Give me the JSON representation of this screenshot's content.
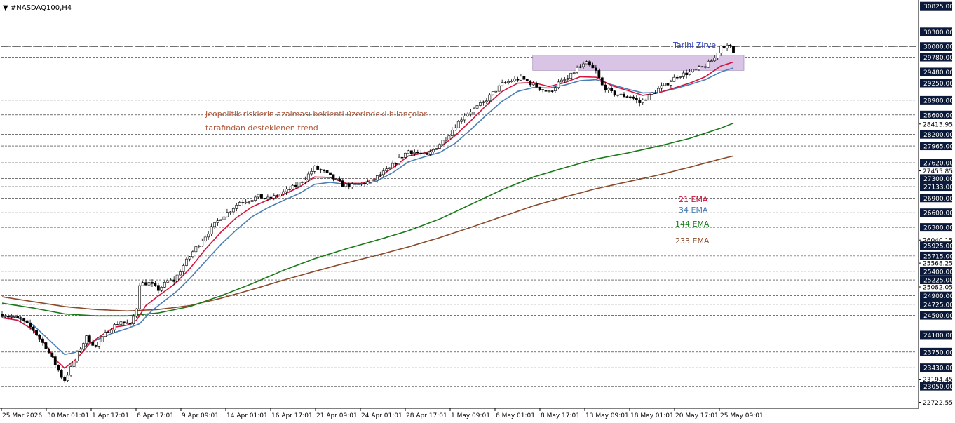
{
  "chart_data": {
    "type": "candlestick",
    "title": "#NASDAQ100,H4",
    "title_marker": "▼",
    "ylim": [
      22600,
      30950
    ],
    "grid": true,
    "background": "#ffffff",
    "colors": {
      "ema21": "#d4143c",
      "ema34": "#4a7fb5",
      "ema144": "#1a7a1a",
      "ema233": "#8b4a2b",
      "zone": "#d9c4e6",
      "ath_line": "#1a1a1a",
      "label_box": "#0b1a3a",
      "annotation_trend": "#b0583a",
      "annotation_ath": "#2b40c0"
    },
    "y_ticks_boxed": [
      "30825.00",
      "30300.00",
      "30000.00",
      "29780.00",
      "29480.00",
      "29250.00",
      "28900.00",
      "28600.00",
      "28200.00",
      "27965.00",
      "27620.00",
      "27300.00",
      "27133.00",
      "26900.00",
      "26600.00",
      "26300.00",
      "25925.00",
      "25715.00",
      "25400.00",
      "25225.00",
      "24900.00",
      "24725.00",
      "24500.00",
      "24100.00",
      "23750.00",
      "23430.00",
      "23050.00"
    ],
    "y_ticks_plain": [
      "28413.95",
      "27455.85",
      "26040.15",
      "25568.25",
      "25082.05",
      "23194.45",
      "22722.55"
    ],
    "x_ticks": [
      "25 Mar 2026",
      "30 Mar 01:01",
      "1 Apr 17:01",
      "6 Apr 17:01",
      "9 Apr 09:01",
      "14 Apr 01:01",
      "16 Apr 17:01",
      "21 Apr 09:01",
      "24 Apr 01:01",
      "28 Apr 17:01",
      "1 May 09:01",
      "6 May 01:01",
      "8 May 17:01",
      "13 May 09:01",
      "18 May 01:01",
      "20 May 17:01",
      "25 May 09:01"
    ],
    "resistance_zone": [
      29510,
      29820
    ],
    "ath_level": 30000,
    "annotations": {
      "trend_line1": "Jeopolitik risklerin azalması beklenti üzerindeki bilançolar",
      "trend_line2": "tarafından desteklenen trend",
      "ath": "Tarihi Zirve"
    },
    "legend": [
      "21 EMA",
      "34 EMA",
      "144 EMA",
      "233 EMA"
    ],
    "price_path": [
      [
        0,
        24520
      ],
      [
        6,
        24420
      ],
      [
        10,
        24200
      ],
      [
        14,
        23850
      ],
      [
        17,
        23500
      ],
      [
        19,
        23250
      ],
      [
        20,
        23180
      ],
      [
        22,
        23420
      ],
      [
        24,
        23720
      ],
      [
        27,
        24050
      ],
      [
        30,
        23860
      ],
      [
        33,
        24120
      ],
      [
        35,
        24250
      ],
      [
        38,
        24380
      ],
      [
        41,
        24290
      ],
      [
        43,
        24660
      ],
      [
        44,
        25150
      ],
      [
        47,
        25160
      ],
      [
        50,
        25030
      ],
      [
        53,
        25200
      ],
      [
        55,
        25210
      ],
      [
        58,
        25520
      ],
      [
        61,
        25800
      ],
      [
        64,
        26050
      ],
      [
        67,
        26280
      ],
      [
        70,
        26500
      ],
      [
        73,
        26650
      ],
      [
        76,
        26820
      ],
      [
        79,
        26860
      ],
      [
        82,
        26930
      ],
      [
        85,
        26880
      ],
      [
        88,
        26950
      ],
      [
        91,
        27050
      ],
      [
        94,
        27150
      ],
      [
        97,
        27310
      ],
      [
        100,
        27520
      ],
      [
        103,
        27430
      ],
      [
        106,
        27300
      ],
      [
        109,
        27170
      ],
      [
        112,
        27150
      ],
      [
        115,
        27190
      ],
      [
        118,
        27230
      ],
      [
        121,
        27380
      ],
      [
        124,
        27500
      ],
      [
        127,
        27700
      ],
      [
        130,
        27870
      ],
      [
        133,
        27820
      ],
      [
        136,
        27760
      ],
      [
        139,
        27950
      ],
      [
        142,
        28130
      ],
      [
        145,
        28380
      ],
      [
        148,
        28600
      ],
      [
        151,
        28720
      ],
      [
        154,
        28850
      ],
      [
        157,
        29050
      ],
      [
        160,
        29230
      ],
      [
        163,
        29300
      ],
      [
        166,
        29350
      ],
      [
        169,
        29250
      ],
      [
        172,
        29150
      ],
      [
        175,
        29060
      ],
      [
        178,
        29250
      ],
      [
        181,
        29340
      ],
      [
        184,
        29550
      ],
      [
        187,
        29650
      ],
      [
        190,
        29490
      ],
      [
        192,
        29200
      ],
      [
        195,
        29050
      ],
      [
        198,
        29000
      ],
      [
        201,
        28980
      ],
      [
        204,
        28850
      ],
      [
        207,
        28990
      ],
      [
        210,
        29130
      ],
      [
        213,
        29250
      ],
      [
        216,
        29400
      ],
      [
        219,
        29450
      ],
      [
        222,
        29520
      ],
      [
        225,
        29600
      ],
      [
        228,
        29760
      ],
      [
        230,
        30020
      ],
      [
        233,
        29980
      ],
      [
        234,
        29880
      ]
    ],
    "ema21_path": [
      [
        0,
        24450
      ],
      [
        5,
        24400
      ],
      [
        10,
        24200
      ],
      [
        14,
        23900
      ],
      [
        17,
        23600
      ],
      [
        20,
        23420
      ],
      [
        24,
        23620
      ],
      [
        28,
        23920
      ],
      [
        32,
        24100
      ],
      [
        36,
        24260
      ],
      [
        40,
        24300
      ],
      [
        43,
        24400
      ],
      [
        46,
        24700
      ],
      [
        50,
        24900
      ],
      [
        55,
        25130
      ],
      [
        60,
        25450
      ],
      [
        65,
        25850
      ],
      [
        70,
        26200
      ],
      [
        75,
        26500
      ],
      [
        80,
        26720
      ],
      [
        85,
        26860
      ],
      [
        90,
        26970
      ],
      [
        95,
        27120
      ],
      [
        100,
        27330
      ],
      [
        105,
        27320
      ],
      [
        110,
        27200
      ],
      [
        115,
        27200
      ],
      [
        120,
        27300
      ],
      [
        125,
        27520
      ],
      [
        130,
        27760
      ],
      [
        135,
        27820
      ],
      [
        140,
        27930
      ],
      [
        145,
        28180
      ],
      [
        150,
        28480
      ],
      [
        155,
        28800
      ],
      [
        160,
        29080
      ],
      [
        165,
        29250
      ],
      [
        170,
        29260
      ],
      [
        175,
        29180
      ],
      [
        180,
        29260
      ],
      [
        185,
        29380
      ],
      [
        190,
        29370
      ],
      [
        195,
        29200
      ],
      [
        200,
        29100
      ],
      [
        205,
        29000
      ],
      [
        210,
        29050
      ],
      [
        215,
        29150
      ],
      [
        220,
        29250
      ],
      [
        225,
        29380
      ],
      [
        230,
        29600
      ],
      [
        234,
        29680
      ]
    ],
    "ema34_path": [
      [
        0,
        24500
      ],
      [
        5,
        24450
      ],
      [
        10,
        24300
      ],
      [
        15,
        24000
      ],
      [
        20,
        23700
      ],
      [
        24,
        23750
      ],
      [
        28,
        23930
      ],
      [
        32,
        24050
      ],
      [
        36,
        24150
      ],
      [
        40,
        24230
      ],
      [
        44,
        24330
      ],
      [
        48,
        24600
      ],
      [
        52,
        24800
      ],
      [
        56,
        25000
      ],
      [
        60,
        25250
      ],
      [
        65,
        25600
      ],
      [
        70,
        25950
      ],
      [
        75,
        26250
      ],
      [
        80,
        26520
      ],
      [
        85,
        26700
      ],
      [
        90,
        26850
      ],
      [
        95,
        26990
      ],
      [
        100,
        27180
      ],
      [
        105,
        27220
      ],
      [
        110,
        27180
      ],
      [
        115,
        27180
      ],
      [
        120,
        27250
      ],
      [
        125,
        27420
      ],
      [
        130,
        27640
      ],
      [
        135,
        27740
      ],
      [
        140,
        27830
      ],
      [
        145,
        28020
      ],
      [
        150,
        28300
      ],
      [
        155,
        28600
      ],
      [
        160,
        28880
      ],
      [
        165,
        29080
      ],
      [
        170,
        29160
      ],
      [
        175,
        29150
      ],
      [
        180,
        29210
      ],
      [
        185,
        29300
      ],
      [
        190,
        29320
      ],
      [
        195,
        29220
      ],
      [
        200,
        29130
      ],
      [
        205,
        29050
      ],
      [
        210,
        29060
      ],
      [
        215,
        29130
      ],
      [
        220,
        29220
      ],
      [
        225,
        29320
      ],
      [
        230,
        29480
      ],
      [
        234,
        29560
      ]
    ],
    "ema144_path": [
      [
        0,
        24750
      ],
      [
        10,
        24650
      ],
      [
        20,
        24530
      ],
      [
        30,
        24490
      ],
      [
        40,
        24490
      ],
      [
        50,
        24550
      ],
      [
        60,
        24680
      ],
      [
        70,
        24900
      ],
      [
        80,
        25150
      ],
      [
        90,
        25420
      ],
      [
        100,
        25660
      ],
      [
        110,
        25860
      ],
      [
        120,
        26040
      ],
      [
        130,
        26230
      ],
      [
        140,
        26470
      ],
      [
        150,
        26770
      ],
      [
        160,
        27070
      ],
      [
        170,
        27330
      ],
      [
        180,
        27520
      ],
      [
        190,
        27700
      ],
      [
        200,
        27820
      ],
      [
        210,
        27960
      ],
      [
        220,
        28120
      ],
      [
        230,
        28330
      ],
      [
        234,
        28430
      ]
    ],
    "ema233_path": [
      [
        0,
        24880
      ],
      [
        10,
        24780
      ],
      [
        20,
        24680
      ],
      [
        30,
        24620
      ],
      [
        40,
        24590
      ],
      [
        50,
        24620
      ],
      [
        60,
        24700
      ],
      [
        70,
        24850
      ],
      [
        80,
        25030
      ],
      [
        90,
        25220
      ],
      [
        100,
        25400
      ],
      [
        110,
        25570
      ],
      [
        120,
        25730
      ],
      [
        130,
        25900
      ],
      [
        140,
        26090
      ],
      [
        150,
        26300
      ],
      [
        160,
        26520
      ],
      [
        170,
        26740
      ],
      [
        180,
        26920
      ],
      [
        190,
        27090
      ],
      [
        200,
        27230
      ],
      [
        210,
        27370
      ],
      [
        220,
        27530
      ],
      [
        230,
        27700
      ],
      [
        234,
        27760
      ]
    ]
  }
}
